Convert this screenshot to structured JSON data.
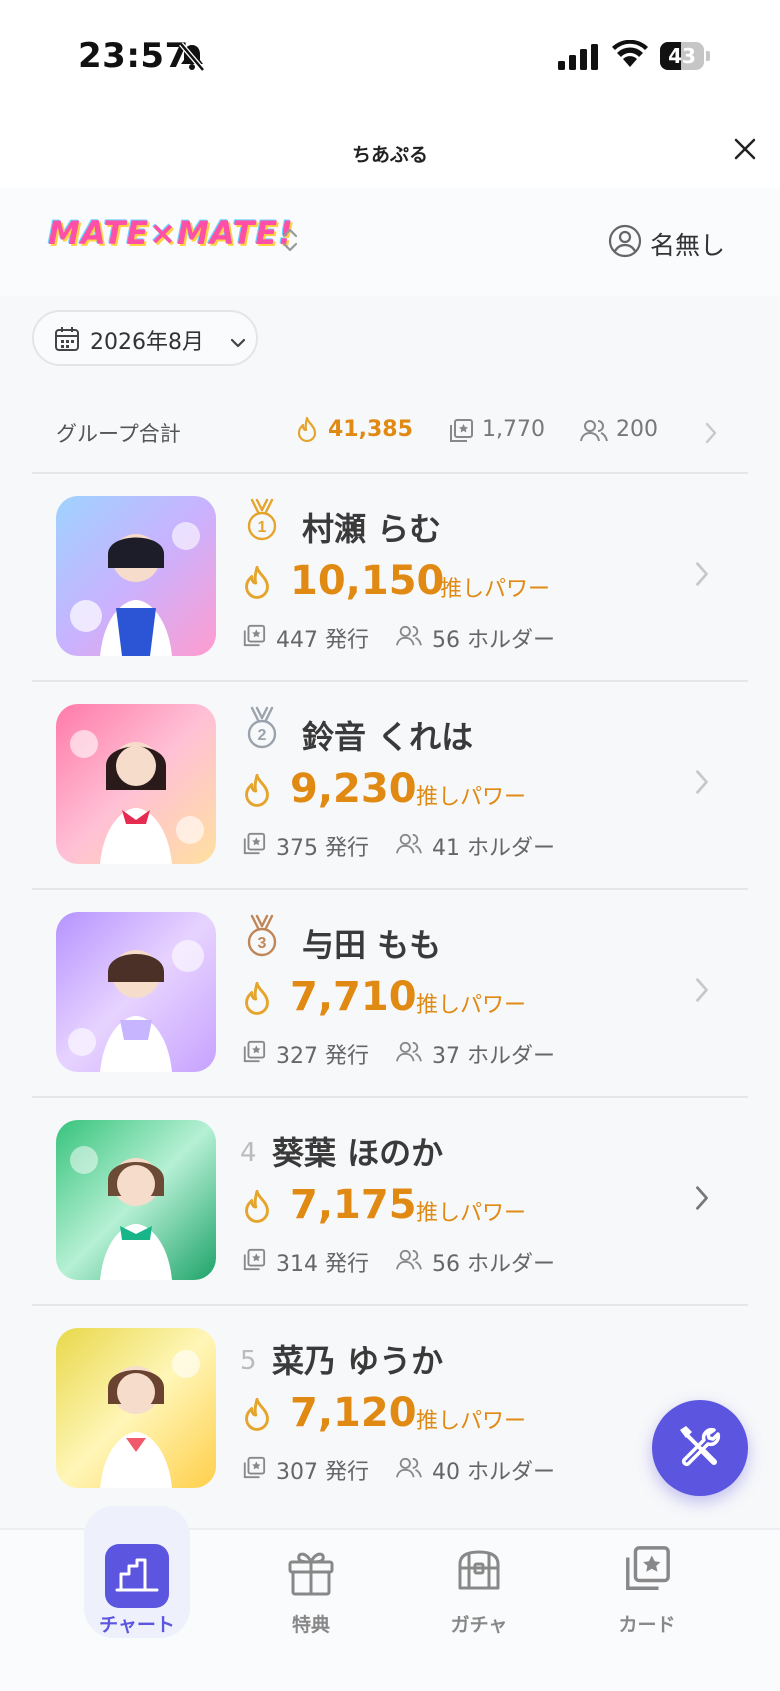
{
  "status_bar": {
    "time": "23:57",
    "battery": "43"
  },
  "app": {
    "title": "ちあぷる"
  },
  "group": {
    "logo_text": "MATE×MATE!",
    "user_name": "名無し"
  },
  "month_selector": {
    "label": "2026年8月"
  },
  "summary": {
    "label": "グループ合計",
    "power": "41,385",
    "cards": "1,770",
    "holders": "200"
  },
  "ranking": [
    {
      "rank": "1",
      "name": "村瀬 らむ",
      "power": "10,150",
      "power_label": "推しパワー",
      "cards": "447 発行",
      "holders": "56 ホルダー"
    },
    {
      "rank": "2",
      "name": "鈴音 くれは",
      "power": "9,230",
      "power_label": "推しパワー",
      "cards": "375 発行",
      "holders": "41 ホルダー"
    },
    {
      "rank": "3",
      "name": "与田 もも",
      "power": "7,710",
      "power_label": "推しパワー",
      "cards": "327 発行",
      "holders": "37 ホルダー"
    },
    {
      "rank": "4",
      "name": "葵葉 ほのか",
      "power": "7,175",
      "power_label": "推しパワー",
      "cards": "314 発行",
      "holders": "56 ホルダー"
    },
    {
      "rank": "5",
      "name": "菜乃 ゆうか",
      "power": "7,120",
      "power_label": "推しパワー",
      "cards": "307 発行",
      "holders": "40 ホルダー"
    }
  ],
  "nav": {
    "items": [
      {
        "label": "チャート",
        "icon": "chart-icon",
        "active": true
      },
      {
        "label": "特典",
        "icon": "gift-icon",
        "active": false
      },
      {
        "label": "ガチャ",
        "icon": "treasure-chest-icon",
        "active": false
      },
      {
        "label": "カード",
        "icon": "card-star-icon",
        "active": false
      }
    ]
  },
  "colors": {
    "accent": "#5b55e0",
    "power": "#e08a13",
    "gold": "#e5a42b",
    "silver": "#9aa3ad",
    "bronze": "#c08657"
  }
}
